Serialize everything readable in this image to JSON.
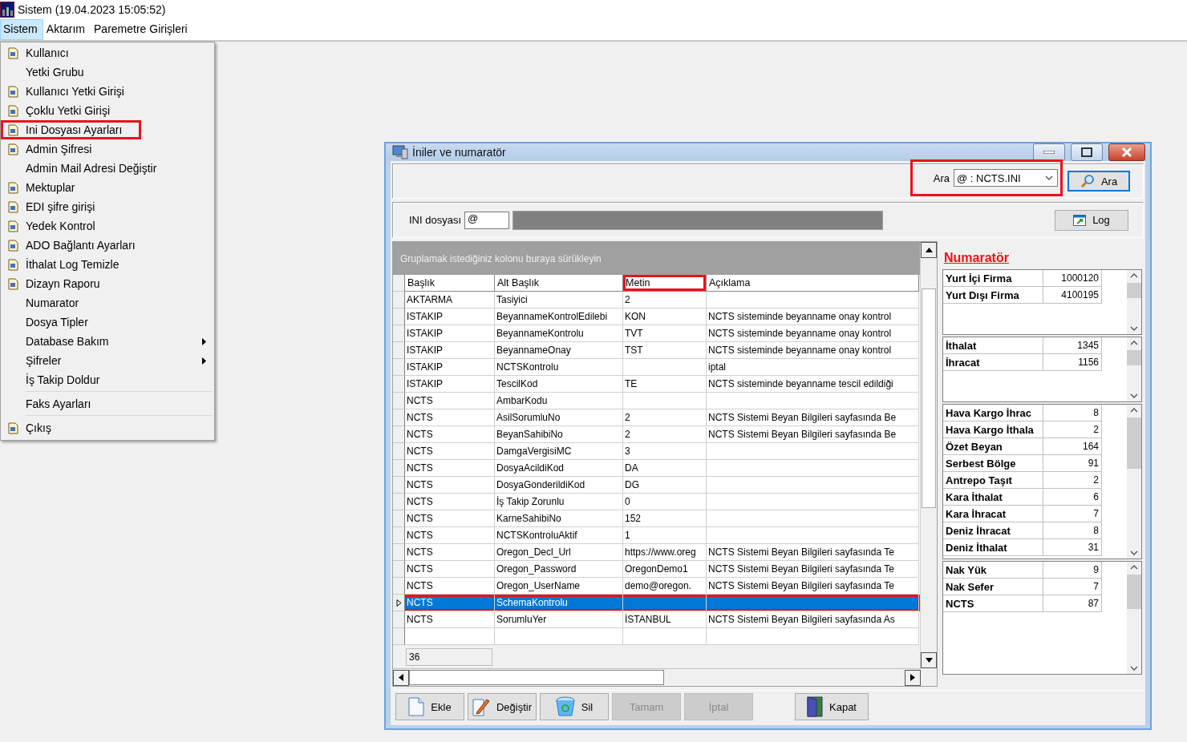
{
  "app": {
    "title": "Sistem (19.04.2023 15:05:52)"
  },
  "menubar": [
    {
      "label": "Sistem",
      "selected": true
    },
    {
      "label": "Aktarım",
      "selected": false
    },
    {
      "label": "Paremetre Girişleri",
      "selected": false
    }
  ],
  "menu": [
    {
      "label": "Kullanıcı",
      "has_icon": true,
      "submenu": false,
      "separator_before": false,
      "highlighted": false
    },
    {
      "label": "Yetki Grubu",
      "has_icon": false,
      "submenu": false,
      "separator_before": false,
      "highlighted": false
    },
    {
      "label": "Kullanıcı Yetki Girişi",
      "has_icon": true,
      "submenu": false,
      "separator_before": false,
      "highlighted": false
    },
    {
      "label": "Çoklu Yetki Girişi",
      "has_icon": true,
      "submenu": false,
      "separator_before": false,
      "highlighted": false
    },
    {
      "label": "Ini Dosyası  Ayarları",
      "has_icon": true,
      "submenu": false,
      "separator_before": false,
      "highlighted": true
    },
    {
      "label": "Admin Şifresi",
      "has_icon": true,
      "submenu": false,
      "separator_before": false,
      "highlighted": false
    },
    {
      "label": "Admin Mail Adresi Değiştir",
      "has_icon": false,
      "submenu": false,
      "separator_before": false,
      "highlighted": false
    },
    {
      "label": "Mektuplar",
      "has_icon": true,
      "submenu": false,
      "separator_before": false,
      "highlighted": false
    },
    {
      "label": "EDI şifre girişi",
      "has_icon": true,
      "submenu": false,
      "separator_before": false,
      "highlighted": false
    },
    {
      "label": "Yedek Kontrol",
      "has_icon": true,
      "submenu": false,
      "separator_before": false,
      "highlighted": false
    },
    {
      "label": "ADO Bağlantı Ayarları",
      "has_icon": true,
      "submenu": false,
      "separator_before": false,
      "highlighted": false
    },
    {
      "label": "İthalat Log Temizle",
      "has_icon": true,
      "submenu": false,
      "separator_before": false,
      "highlighted": false
    },
    {
      "label": "Dizayn Raporu",
      "has_icon": true,
      "submenu": false,
      "separator_before": false,
      "highlighted": false
    },
    {
      "label": "Numarator",
      "has_icon": false,
      "submenu": false,
      "separator_before": false,
      "highlighted": false
    },
    {
      "label": "Dosya Tipler",
      "has_icon": false,
      "submenu": false,
      "separator_before": false,
      "highlighted": false
    },
    {
      "label": "Database Bakım",
      "has_icon": false,
      "submenu": true,
      "separator_before": false,
      "highlighted": false
    },
    {
      "label": "Şifreler",
      "has_icon": false,
      "submenu": true,
      "separator_before": false,
      "highlighted": false
    },
    {
      "label": "İş Takip Doldur",
      "has_icon": false,
      "submenu": false,
      "separator_before": false,
      "highlighted": false
    },
    {
      "label": "Faks Ayarları",
      "has_icon": false,
      "submenu": false,
      "separator_before": true,
      "highlighted": false
    },
    {
      "label": "Çıkış",
      "has_icon": true,
      "submenu": false,
      "separator_before": true,
      "highlighted": false
    }
  ],
  "dialog": {
    "title": "İniler ve numaratör",
    "search": {
      "label": "Ara",
      "value": "@ : NCTS.INI",
      "button": "Ara",
      "highlighted": true
    },
    "ini": {
      "label": "INI dosyası",
      "value": "@",
      "log_button": "Log"
    },
    "grid": {
      "group_hint": "Gruplamak istediğiniz kolonu buraya sürükleyin",
      "columns": [
        {
          "label": "Başlık",
          "highlighted": false
        },
        {
          "label": "Alt Başlık",
          "highlighted": false
        },
        {
          "label": "Metin",
          "highlighted": true
        },
        {
          "label": "Açıklama",
          "highlighted": false
        }
      ],
      "rows": [
        {
          "cells": [
            "AKTARMA",
            "Tasiyici",
            "2",
            ""
          ],
          "selected": false,
          "highlighted": false
        },
        {
          "cells": [
            "ISTAKIP",
            "BeyannameKontrolEdilebi",
            "KON",
            "NCTS sisteminde beyanname onay kontrol"
          ],
          "selected": false,
          "highlighted": false
        },
        {
          "cells": [
            "ISTAKIP",
            "BeyannameKontrolu",
            "TVT",
            "NCTS sisteminde beyanname onay kontrol"
          ],
          "selected": false,
          "highlighted": false
        },
        {
          "cells": [
            "ISTAKIP",
            "BeyannameOnay",
            "TST",
            "NCTS sisteminde beyanname onay kontrol"
          ],
          "selected": false,
          "highlighted": false
        },
        {
          "cells": [
            "ISTAKIP",
            "NCTSKontrolu",
            "",
            "iptal"
          ],
          "selected": false,
          "highlighted": false
        },
        {
          "cells": [
            "ISTAKIP",
            "TescilKod",
            "TE",
            "NCTS sisteminde beyanname tescil edildiği"
          ],
          "selected": false,
          "highlighted": false
        },
        {
          "cells": [
            "NCTS",
            "AmbarKodu",
            "",
            ""
          ],
          "selected": false,
          "highlighted": false
        },
        {
          "cells": [
            "NCTS",
            "AsilSorumluNo",
            "2",
            "NCTS Sistemi Beyan Bilgileri sayfasında Be"
          ],
          "selected": false,
          "highlighted": false
        },
        {
          "cells": [
            "NCTS",
            "BeyanSahibiNo",
            "2",
            "NCTS Sistemi Beyan Bilgileri sayfasında Be"
          ],
          "selected": false,
          "highlighted": false
        },
        {
          "cells": [
            "NCTS",
            "DamgaVergisiMC",
            "3",
            ""
          ],
          "selected": false,
          "highlighted": false
        },
        {
          "cells": [
            "NCTS",
            "DosyaAcildiKod",
            "DA",
            ""
          ],
          "selected": false,
          "highlighted": false
        },
        {
          "cells": [
            "NCTS",
            "DosyaGonderildiKod",
            "DG",
            ""
          ],
          "selected": false,
          "highlighted": false
        },
        {
          "cells": [
            "NCTS",
            "İş Takip Zorunlu",
            "0",
            ""
          ],
          "selected": false,
          "highlighted": false
        },
        {
          "cells": [
            "NCTS",
            "KarneSahibiNo",
            "152",
            ""
          ],
          "selected": false,
          "highlighted": false
        },
        {
          "cells": [
            "NCTS",
            "NCTSKontroluAktif",
            "1",
            ""
          ],
          "selected": false,
          "highlighted": false
        },
        {
          "cells": [
            "NCTS",
            "Oregon_Decl_Url",
            "https://www.oreg",
            "NCTS Sistemi Beyan Bilgileri sayfasında Te"
          ],
          "selected": false,
          "highlighted": false
        },
        {
          "cells": [
            "NCTS",
            "Oregon_Password",
            "OregonDemo1",
            "NCTS Sistemi Beyan Bilgileri sayfasında Te"
          ],
          "selected": false,
          "highlighted": false
        },
        {
          "cells": [
            "NCTS",
            "Oregon_UserName",
            "demo@oregon.",
            "NCTS Sistemi Beyan Bilgileri sayfasında Te"
          ],
          "selected": false,
          "highlighted": false
        },
        {
          "cells": [
            "NCTS",
            "SchemaKontrolu",
            "",
            ""
          ],
          "selected": true,
          "highlighted": true
        },
        {
          "cells": [
            "NCTS",
            "SorumluYer",
            "İSTANBUL",
            "NCTS Sistemi Beyan Bilgileri sayfasında As"
          ],
          "selected": false,
          "highlighted": false
        }
      ],
      "count": "36"
    },
    "buttons": [
      {
        "label": "Ekle",
        "kind": "add",
        "disabled": false
      },
      {
        "label": "Değiştir",
        "kind": "edit",
        "disabled": false
      },
      {
        "label": "Sil",
        "kind": "delete",
        "disabled": false
      },
      {
        "label": "Tamam",
        "kind": "confirm",
        "disabled": true
      },
      {
        "label": "İptal",
        "kind": "cancel",
        "disabled": true
      },
      {
        "label": "Kapat",
        "kind": "close",
        "disabled": false
      }
    ],
    "numarator": {
      "title": "Numaratör",
      "lists": [
        {
          "rows": [
            {
              "label": "Yurt İçi Firma",
              "value": "1000120"
            },
            {
              "label": "Yurt Dışı Firma",
              "value": "4100195"
            }
          ]
        },
        {
          "rows": [
            {
              "label": "İthalat",
              "value": "1345"
            },
            {
              "label": "İhracat",
              "value": "1156"
            }
          ]
        },
        {
          "rows": [
            {
              "label": "Hava Kargo İhrac",
              "value": "8"
            },
            {
              "label": "Hava Kargo İthala",
              "value": "2"
            },
            {
              "label": "Özet Beyan",
              "value": "164"
            },
            {
              "label": "Serbest Bölge",
              "value": "91"
            },
            {
              "label": "Antrepo Taşıt",
              "value": "2"
            },
            {
              "label": "Kara İthalat",
              "value": "6"
            },
            {
              "label": "Kara İhracat",
              "value": "7"
            },
            {
              "label": "Deniz İhracat",
              "value": "8"
            },
            {
              "label": "Deniz İthalat",
              "value": "31"
            }
          ]
        },
        {
          "rows": [
            {
              "label": "Nak Yük",
              "value": "9"
            },
            {
              "label": "Nak Sefer",
              "value": "7"
            },
            {
              "label": "NCTS",
              "value": "87"
            }
          ]
        }
      ]
    }
  }
}
